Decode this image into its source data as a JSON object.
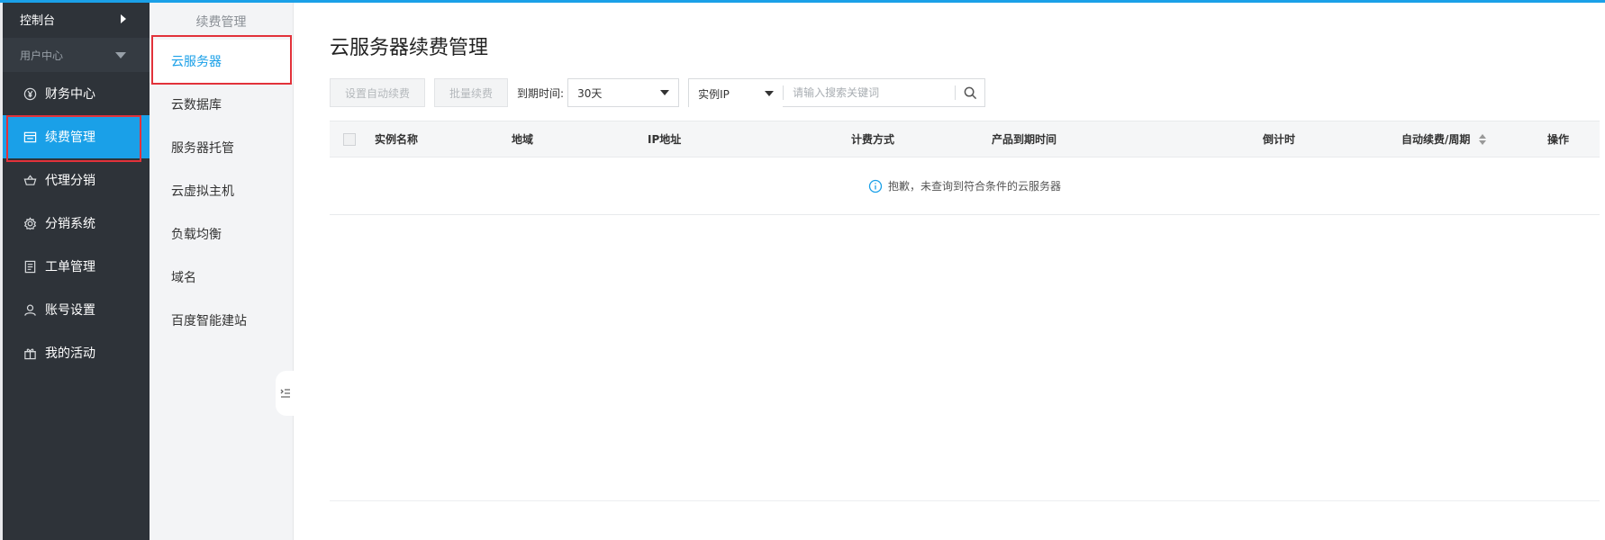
{
  "sidebar": {
    "top_label": "控制台",
    "section_label": "用户中心",
    "items": [
      {
        "label": "财务中心",
        "icon": "yen-circle-icon"
      },
      {
        "label": "续费管理",
        "icon": "renew-card-icon"
      },
      {
        "label": "代理分销",
        "icon": "basket-icon"
      },
      {
        "label": "分销系统",
        "icon": "gear-icon"
      },
      {
        "label": "工单管理",
        "icon": "document-icon"
      },
      {
        "label": "账号设置",
        "icon": "user-icon"
      },
      {
        "label": "我的活动",
        "icon": "gift-icon"
      }
    ]
  },
  "submenu": {
    "title": "续费管理",
    "items": [
      "云服务器",
      "云数据库",
      "服务器托管",
      "云虚拟主机",
      "负载均衡",
      "域名",
      "百度智能建站"
    ]
  },
  "main": {
    "title": "云服务器续费管理",
    "toolbar": {
      "auto_renew_btn": "设置自动续费",
      "batch_renew_btn": "批量续费",
      "expire_label": "到期时间:",
      "expire_value": "30天",
      "search_type": "实例IP",
      "search_placeholder": "请输入搜索关键词"
    },
    "table": {
      "columns": [
        "实例名称",
        "地域",
        "IP地址",
        "计费方式",
        "产品到期时间",
        "倒计时",
        "自动续费/周期",
        "操作"
      ],
      "empty_text": "抱歉，未查询到符合条件的云服务器"
    }
  },
  "colors": {
    "accent": "#1aa0e8",
    "sidebar_bg": "#2e3339",
    "highlight_border": "#e2323a"
  }
}
